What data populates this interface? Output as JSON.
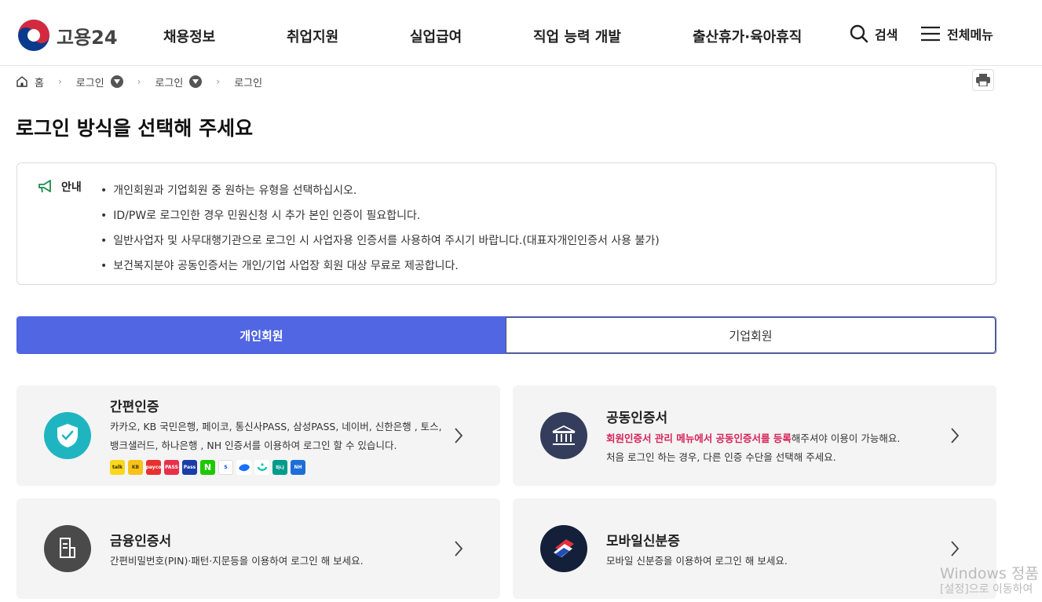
{
  "header": {
    "logo_text": "고용24",
    "nav": [
      "채용정보",
      "취업지원",
      "실업급여",
      "직업 능력 개발",
      "출산휴가·육아휴직"
    ],
    "search_label": "검색",
    "menu_label": "전체메뉴"
  },
  "breadcrumb": {
    "home": "홈",
    "items": [
      "로그인",
      "로그인",
      "로그인"
    ]
  },
  "page_title": "로그인 방식을 선택해 주세요",
  "notice": {
    "label": "안내",
    "items": [
      "개인회원과 기업회원 중 원하는 유형을 선택하십시오.",
      "ID/PW로 로그인한 경우 민원신청 시 추가 본인 인증이 필요합니다.",
      "일반사업자 및 사무대행기관으로 로그인 시 사업자용 인증서를 사용하여 주시기 바랍니다.(대표자개인인증서 사용 불가)",
      "보건복지분야 공동인증서는 개인/기업 사업장 회원 대상 무료로 제공합니다."
    ]
  },
  "tabs": {
    "personal": "개인회원",
    "corporate": "기업회원",
    "active": "personal"
  },
  "cards": {
    "simple": {
      "title": "간편인증",
      "desc1": "카카오, KB 국민은행, 페이코, 통신사PASS, 삼성PASS, 네이버, 신한은행 , 토스,",
      "desc2": "뱅크샐러드, 하나은행 , NH 인증서를 이용하여 로그인 할 수 있습니다.",
      "providers": [
        "kakao-icon",
        "kb-icon",
        "payco-icon",
        "pass-icon",
        "samsung-pass-icon",
        "naver-icon",
        "shinhan-icon",
        "toss-icon",
        "banksalad-icon",
        "hana-icon",
        "nh-icon"
      ]
    },
    "joint": {
      "title": "공동인증서",
      "desc_highlight": "회원인증서 관리 메뉴에서 공동인증서를 등록",
      "desc_rest": "해주셔야 이용이 가능해요.",
      "desc2": "처음 로그인 하는 경우, 다른 인증 수단을 선택해 주세요."
    },
    "financial": {
      "title": "금융인증서",
      "desc": "간편비밀번호(PIN)·패턴·지문등을 이용하여 로그인 해 보세요."
    },
    "mobile": {
      "title": "모바일신분증",
      "desc": "모바일 신분증을 이용하여 로그인 해 보세요."
    }
  },
  "watermark": {
    "line1": "Windows 정품",
    "line2": "[설정]으로 이동하여"
  },
  "colors": {
    "accent": "#5166e3",
    "highlight": "#d6245a",
    "shield": "#1fb5c0",
    "navy": "#353d5c"
  }
}
